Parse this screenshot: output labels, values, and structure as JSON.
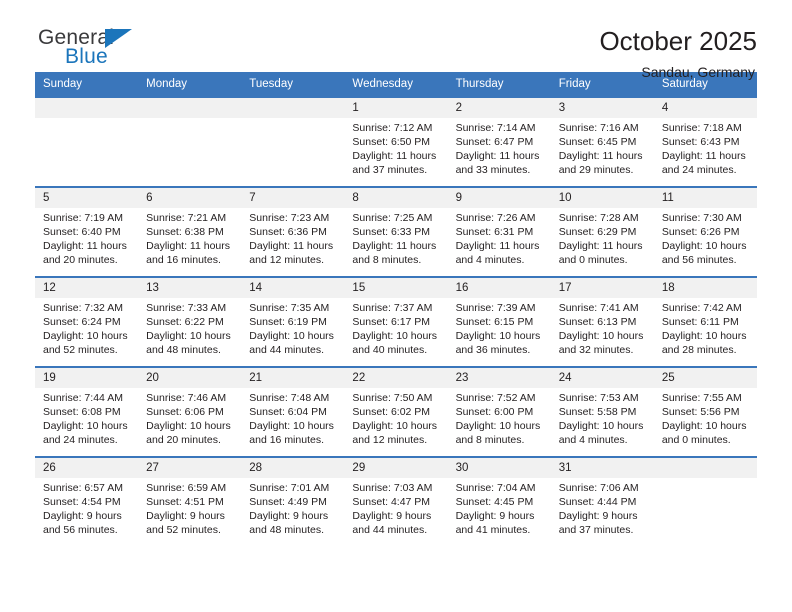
{
  "brand": {
    "name_part1": "General",
    "name_part2": "Blue",
    "triangle_color": "#1b75bb",
    "text_color": "#3a3a3c"
  },
  "header": {
    "title": "October 2025",
    "subtitle": "Sandau, Germany"
  },
  "theme": {
    "header_bg": "#3a76bb",
    "header_text": "#ffffff",
    "daynum_bg": "#f1f1f1",
    "body_text": "#231f20"
  },
  "weekday_headers": [
    "Sunday",
    "Monday",
    "Tuesday",
    "Wednesday",
    "Thursday",
    "Friday",
    "Saturday"
  ],
  "labels": {
    "sunrise_prefix": "Sunrise:",
    "sunset_prefix": "Sunset:",
    "daylight_prefix": "Daylight:"
  },
  "weeks": [
    [
      {
        "day": "",
        "line1": "",
        "line2": "",
        "line3": "",
        "line4": ""
      },
      {
        "day": "",
        "line1": "",
        "line2": "",
        "line3": "",
        "line4": ""
      },
      {
        "day": "",
        "line1": "",
        "line2": "",
        "line3": "",
        "line4": ""
      },
      {
        "day": "1",
        "line1": "Sunrise: 7:12 AM",
        "line2": "Sunset: 6:50 PM",
        "line3": "Daylight: 11 hours",
        "line4": "and 37 minutes."
      },
      {
        "day": "2",
        "line1": "Sunrise: 7:14 AM",
        "line2": "Sunset: 6:47 PM",
        "line3": "Daylight: 11 hours",
        "line4": "and 33 minutes."
      },
      {
        "day": "3",
        "line1": "Sunrise: 7:16 AM",
        "line2": "Sunset: 6:45 PM",
        "line3": "Daylight: 11 hours",
        "line4": "and 29 minutes."
      },
      {
        "day": "4",
        "line1": "Sunrise: 7:18 AM",
        "line2": "Sunset: 6:43 PM",
        "line3": "Daylight: 11 hours",
        "line4": "and 24 minutes."
      }
    ],
    [
      {
        "day": "5",
        "line1": "Sunrise: 7:19 AM",
        "line2": "Sunset: 6:40 PM",
        "line3": "Daylight: 11 hours",
        "line4": "and 20 minutes."
      },
      {
        "day": "6",
        "line1": "Sunrise: 7:21 AM",
        "line2": "Sunset: 6:38 PM",
        "line3": "Daylight: 11 hours",
        "line4": "and 16 minutes."
      },
      {
        "day": "7",
        "line1": "Sunrise: 7:23 AM",
        "line2": "Sunset: 6:36 PM",
        "line3": "Daylight: 11 hours",
        "line4": "and 12 minutes."
      },
      {
        "day": "8",
        "line1": "Sunrise: 7:25 AM",
        "line2": "Sunset: 6:33 PM",
        "line3": "Daylight: 11 hours",
        "line4": "and 8 minutes."
      },
      {
        "day": "9",
        "line1": "Sunrise: 7:26 AM",
        "line2": "Sunset: 6:31 PM",
        "line3": "Daylight: 11 hours",
        "line4": "and 4 minutes."
      },
      {
        "day": "10",
        "line1": "Sunrise: 7:28 AM",
        "line2": "Sunset: 6:29 PM",
        "line3": "Daylight: 11 hours",
        "line4": "and 0 minutes."
      },
      {
        "day": "11",
        "line1": "Sunrise: 7:30 AM",
        "line2": "Sunset: 6:26 PM",
        "line3": "Daylight: 10 hours",
        "line4": "and 56 minutes."
      }
    ],
    [
      {
        "day": "12",
        "line1": "Sunrise: 7:32 AM",
        "line2": "Sunset: 6:24 PM",
        "line3": "Daylight: 10 hours",
        "line4": "and 52 minutes."
      },
      {
        "day": "13",
        "line1": "Sunrise: 7:33 AM",
        "line2": "Sunset: 6:22 PM",
        "line3": "Daylight: 10 hours",
        "line4": "and 48 minutes."
      },
      {
        "day": "14",
        "line1": "Sunrise: 7:35 AM",
        "line2": "Sunset: 6:19 PM",
        "line3": "Daylight: 10 hours",
        "line4": "and 44 minutes."
      },
      {
        "day": "15",
        "line1": "Sunrise: 7:37 AM",
        "line2": "Sunset: 6:17 PM",
        "line3": "Daylight: 10 hours",
        "line4": "and 40 minutes."
      },
      {
        "day": "16",
        "line1": "Sunrise: 7:39 AM",
        "line2": "Sunset: 6:15 PM",
        "line3": "Daylight: 10 hours",
        "line4": "and 36 minutes."
      },
      {
        "day": "17",
        "line1": "Sunrise: 7:41 AM",
        "line2": "Sunset: 6:13 PM",
        "line3": "Daylight: 10 hours",
        "line4": "and 32 minutes."
      },
      {
        "day": "18",
        "line1": "Sunrise: 7:42 AM",
        "line2": "Sunset: 6:11 PM",
        "line3": "Daylight: 10 hours",
        "line4": "and 28 minutes."
      }
    ],
    [
      {
        "day": "19",
        "line1": "Sunrise: 7:44 AM",
        "line2": "Sunset: 6:08 PM",
        "line3": "Daylight: 10 hours",
        "line4": "and 24 minutes."
      },
      {
        "day": "20",
        "line1": "Sunrise: 7:46 AM",
        "line2": "Sunset: 6:06 PM",
        "line3": "Daylight: 10 hours",
        "line4": "and 20 minutes."
      },
      {
        "day": "21",
        "line1": "Sunrise: 7:48 AM",
        "line2": "Sunset: 6:04 PM",
        "line3": "Daylight: 10 hours",
        "line4": "and 16 minutes."
      },
      {
        "day": "22",
        "line1": "Sunrise: 7:50 AM",
        "line2": "Sunset: 6:02 PM",
        "line3": "Daylight: 10 hours",
        "line4": "and 12 minutes."
      },
      {
        "day": "23",
        "line1": "Sunrise: 7:52 AM",
        "line2": "Sunset: 6:00 PM",
        "line3": "Daylight: 10 hours",
        "line4": "and 8 minutes."
      },
      {
        "day": "24",
        "line1": "Sunrise: 7:53 AM",
        "line2": "Sunset: 5:58 PM",
        "line3": "Daylight: 10 hours",
        "line4": "and 4 minutes."
      },
      {
        "day": "25",
        "line1": "Sunrise: 7:55 AM",
        "line2": "Sunset: 5:56 PM",
        "line3": "Daylight: 10 hours",
        "line4": "and 0 minutes."
      }
    ],
    [
      {
        "day": "26",
        "line1": "Sunrise: 6:57 AM",
        "line2": "Sunset: 4:54 PM",
        "line3": "Daylight: 9 hours",
        "line4": "and 56 minutes."
      },
      {
        "day": "27",
        "line1": "Sunrise: 6:59 AM",
        "line2": "Sunset: 4:51 PM",
        "line3": "Daylight: 9 hours",
        "line4": "and 52 minutes."
      },
      {
        "day": "28",
        "line1": "Sunrise: 7:01 AM",
        "line2": "Sunset: 4:49 PM",
        "line3": "Daylight: 9 hours",
        "line4": "and 48 minutes."
      },
      {
        "day": "29",
        "line1": "Sunrise: 7:03 AM",
        "line2": "Sunset: 4:47 PM",
        "line3": "Daylight: 9 hours",
        "line4": "and 44 minutes."
      },
      {
        "day": "30",
        "line1": "Sunrise: 7:04 AM",
        "line2": "Sunset: 4:45 PM",
        "line3": "Daylight: 9 hours",
        "line4": "and 41 minutes."
      },
      {
        "day": "31",
        "line1": "Sunrise: 7:06 AM",
        "line2": "Sunset: 4:44 PM",
        "line3": "Daylight: 9 hours",
        "line4": "and 37 minutes."
      },
      {
        "day": "",
        "line1": "",
        "line2": "",
        "line3": "",
        "line4": ""
      }
    ]
  ]
}
